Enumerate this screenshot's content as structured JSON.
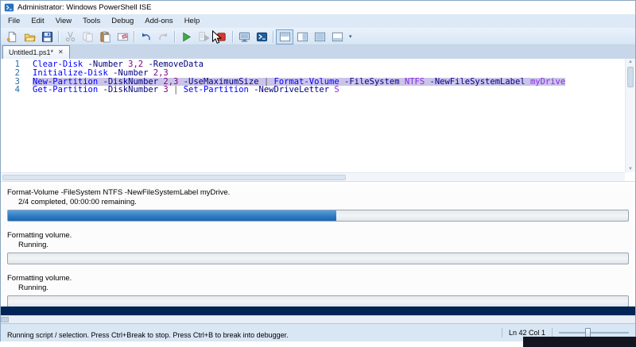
{
  "window": {
    "title": "Administrator: Windows PowerShell ISE"
  },
  "menu": {
    "items": [
      "File",
      "Edit",
      "View",
      "Tools",
      "Debug",
      "Add-ons",
      "Help"
    ]
  },
  "toolbar": {
    "groups": [
      [
        "new-script",
        "open-script",
        "save-script"
      ],
      [
        "cut",
        "copy",
        "paste",
        "clear-console-pane"
      ],
      [
        "undo",
        "redo"
      ],
      [
        "run-script",
        "run-selection",
        "stop-operation"
      ],
      [
        "new-remote-powershell-tab",
        "start-powershell"
      ],
      [
        "script-pane-top",
        "script-pane-right",
        "script-pane-maximized",
        "show-command-window"
      ]
    ],
    "active_icon": "script-pane-top",
    "disabled_icons": [
      "cut",
      "copy",
      "redo",
      "run-selection"
    ]
  },
  "tabs": [
    {
      "label": "Untitled1.ps1*",
      "active": true
    }
  ],
  "editor": {
    "lines": [
      {
        "number": "1",
        "selected": false,
        "tokens": [
          [
            "Clear-Disk",
            "cmdlet"
          ],
          [
            " ",
            "plain"
          ],
          [
            "-Number",
            "param"
          ],
          [
            " ",
            "plain"
          ],
          [
            "3,2",
            "number"
          ],
          [
            " ",
            "plain"
          ],
          [
            "-RemoveData",
            "param"
          ]
        ]
      },
      {
        "number": "2",
        "selected": false,
        "tokens": [
          [
            "Initialize-Disk",
            "cmdlet"
          ],
          [
            " ",
            "plain"
          ],
          [
            "-Number",
            "param"
          ],
          [
            " ",
            "plain"
          ],
          [
            "2,3",
            "number"
          ]
        ]
      },
      {
        "number": "3",
        "selected": true,
        "tokens": [
          [
            "New-Partition",
            "cmdlet"
          ],
          [
            " ",
            "plain"
          ],
          [
            "-DiskNumber",
            "param"
          ],
          [
            " ",
            "plain"
          ],
          [
            "2,3",
            "number"
          ],
          [
            " ",
            "plain"
          ],
          [
            "-UseMaximumSize",
            "param"
          ],
          [
            " ",
            "plain"
          ],
          [
            "|",
            "operator"
          ],
          [
            " ",
            "plain"
          ],
          [
            "Format-Volume",
            "cmdlet"
          ],
          [
            " ",
            "plain"
          ],
          [
            "-FileSystem",
            "param"
          ],
          [
            " ",
            "plain"
          ],
          [
            "NTFS",
            "argument"
          ],
          [
            " ",
            "plain"
          ],
          [
            "-NewFileSystemLabel",
            "param"
          ],
          [
            " ",
            "plain"
          ],
          [
            "myDrive",
            "argument"
          ]
        ]
      },
      {
        "number": "4",
        "selected": false,
        "tokens": [
          [
            "Get-Partition",
            "cmdlet"
          ],
          [
            " ",
            "plain"
          ],
          [
            "-DiskNumber",
            "param"
          ],
          [
            " ",
            "plain"
          ],
          [
            "3",
            "number"
          ],
          [
            " ",
            "plain"
          ],
          [
            "|",
            "operator"
          ],
          [
            " ",
            "plain"
          ],
          [
            "Set-Partition",
            "cmdlet"
          ],
          [
            " ",
            "plain"
          ],
          [
            "-NewDriveLetter",
            "param"
          ],
          [
            " ",
            "plain"
          ],
          [
            "S",
            "argument"
          ]
        ]
      }
    ]
  },
  "syntax_colors": {
    "cmdlet": "#0000FF",
    "param": "#000080",
    "number": "#800080",
    "operator": "#5A5A5A",
    "argument": "#8A2BE2",
    "plain": "#000000",
    "selection_bg": "#CBC4E9",
    "line_number": "#2B6A9E"
  },
  "progress_pane": {
    "main": {
      "activity": "Format-Volume -FileSystem NTFS -NewFileSystemLabel myDrive.",
      "status": "2/4 completed, 00:00:00 remaining.",
      "percent": 53
    },
    "children": [
      {
        "activity": "Formatting volume.",
        "status": "Running.",
        "percent": 0
      },
      {
        "activity": "Formatting volume.",
        "status": "Running.",
        "percent": 0
      }
    ],
    "fill_color": "#2E7CC4"
  },
  "console": {
    "bg": "#012456"
  },
  "statusbar": {
    "message": "Running script / selection. Press Ctrl+Break to stop. Press Ctrl+B to break into debugger.",
    "position": "Ln 42 Col 1"
  }
}
